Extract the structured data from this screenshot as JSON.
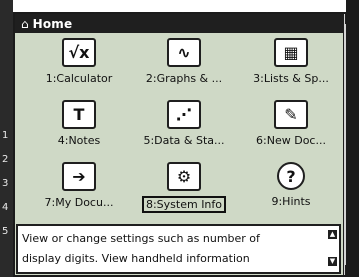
{
  "header": {
    "title": "Home"
  },
  "rail_numbers": [
    "1",
    "2",
    "3",
    "4",
    "5"
  ],
  "apps": [
    {
      "label": "1:Calculator",
      "icon": "√x",
      "name": "calculator"
    },
    {
      "label": "2:Graphs & ...",
      "icon": "∿",
      "name": "graphs"
    },
    {
      "label": "3:Lists & Sp...",
      "icon": "▦",
      "name": "lists-spreadsheet"
    },
    {
      "label": "4:Notes",
      "icon": "T",
      "name": "notes"
    },
    {
      "label": "5:Data & Sta...",
      "icon": "⋰",
      "name": "data-statistics"
    },
    {
      "label": "6:New Doc...",
      "icon": "✎",
      "name": "new-document"
    },
    {
      "label": "7:My Docu...",
      "icon": "➔",
      "name": "my-documents"
    },
    {
      "label": "8:System Info",
      "icon": "⚙",
      "name": "system-info"
    },
    {
      "label": "9:Hints",
      "icon": "?",
      "name": "hints"
    }
  ],
  "selected_index": 7,
  "description": {
    "line1": "View or change settings such as number of",
    "line2": "display digits.  View handheld information"
  },
  "colors": {
    "screen_bg": "#cfd9c6",
    "bar": "#1f1f1f"
  }
}
